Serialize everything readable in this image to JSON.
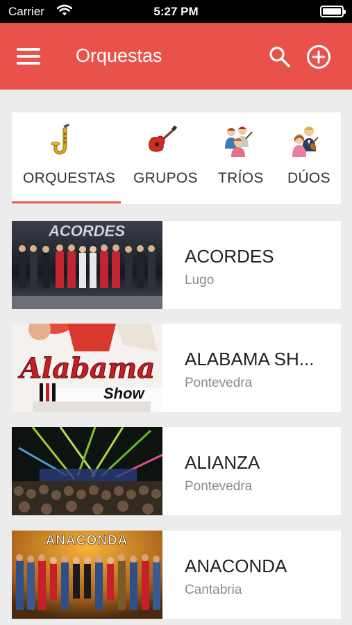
{
  "status_bar": {
    "carrier": "Carrier",
    "time": "5:27 PM"
  },
  "header": {
    "title": "Orquestas"
  },
  "categories": [
    {
      "label": "ORQUESTAS",
      "icon": "saxophone-icon"
    },
    {
      "label": "GRUPOS",
      "icon": "electric-guitar-icon"
    },
    {
      "label": "TRÍOS",
      "icon": "trio-musicians-icon"
    },
    {
      "label": "DÚOS",
      "icon": "duo-musicians-icon"
    }
  ],
  "selected_category": "ORQUESTAS",
  "accent_color": "#e9524a",
  "list": [
    {
      "name": "ACORDES",
      "place": "Lugo",
      "thumb_text": "ACORDES"
    },
    {
      "name": "ALABAMA SH...",
      "place": "Pontevedra",
      "thumb_text": "Alabama",
      "thumb_text2": "Show"
    },
    {
      "name": "ALIANZA",
      "place": "Pontevedra"
    },
    {
      "name": "ANACONDA",
      "place": "Cantabria",
      "thumb_text": "ANACONDA"
    }
  ]
}
